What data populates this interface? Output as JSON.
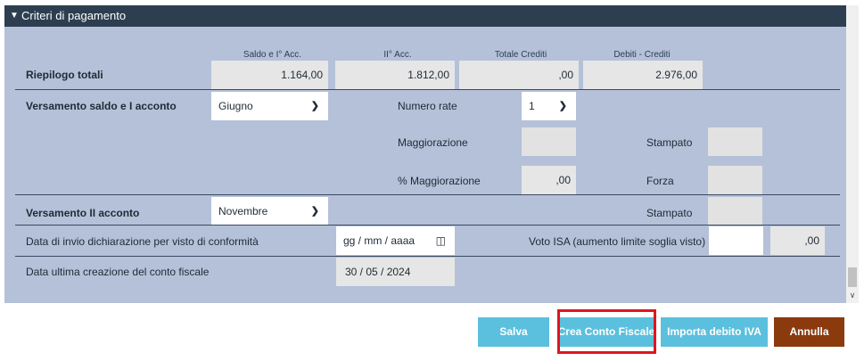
{
  "panel": {
    "title": "Criteri di pagamento",
    "caret_icon": "caret-down-icon"
  },
  "columns": [
    "Saldo e I° Acc.",
    "II° Acc.",
    "Totale Crediti",
    "Debiti - Crediti"
  ],
  "riepilogo": {
    "label": "Riepilogo totali",
    "saldo": "1.164,00",
    "secondo_acc": "1.812,00",
    "totale_crediti": ",00",
    "debiti_crediti": "2.976,00"
  },
  "versamento_saldo": {
    "label": "Versamento saldo e I acconto",
    "month": "Giugno",
    "numero_rate_label": "Numero rate",
    "numero_rate_value": "1",
    "maggiorazione_label": "Maggiorazione",
    "maggiorazione_value": "",
    "stampato_label": "Stampato",
    "perc_maggiorazione_label": "% Maggiorazione",
    "perc_maggiorazione_value": ",00",
    "forza_label": "Forza"
  },
  "versamento_secondo": {
    "label": "Versamento II acconto",
    "month": "Novembre",
    "stampato_label": "Stampato"
  },
  "data_invio": {
    "label": "Data di invio dichiarazione per visto di conformità",
    "placeholder": "gg / mm / aaaa",
    "voto_isa_label": "Voto ISA (aumento limite soglia visto)",
    "voto_isa_value": "",
    "voto_isa_amount": ",00"
  },
  "data_ultima": {
    "label": "Data ultima creazione del conto fiscale",
    "value": "30 / 05 / 2024"
  },
  "buttons": {
    "salva": "Salva",
    "crea": "Crea Conto Fiscale",
    "importa": "Importa debito IVA",
    "annulla": "Annulla"
  },
  "colors": {
    "header": "#2c3e50",
    "panel": "#b4c1d8",
    "btn_blue": "#5bc0de",
    "btn_brown": "#8b3a0e",
    "highlight": "#e0151e"
  }
}
